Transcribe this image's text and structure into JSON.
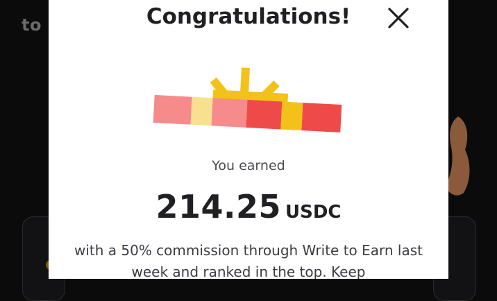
{
  "background": {
    "partial_text": "to",
    "right_decoration_icon": "hand-icon"
  },
  "modal": {
    "title": "Congratulations!",
    "close_icon": "close-icon",
    "illustration_icon": "gift-box-icon",
    "earned_label": "You earned",
    "amount": "214.25",
    "currency": "USDC",
    "description": "with a 50% commission through Write to Earn last week and ranked in the top. Keep"
  },
  "colors": {
    "modal_background": "#ffffff",
    "page_background": "#0b0b0c",
    "gift_pink": "#f58b8b",
    "gift_red": "#ef4a4a",
    "gift_yellow": "#f3c21a",
    "gift_pale_yellow": "#f7e08f",
    "text_dark": "#1f1f24"
  }
}
